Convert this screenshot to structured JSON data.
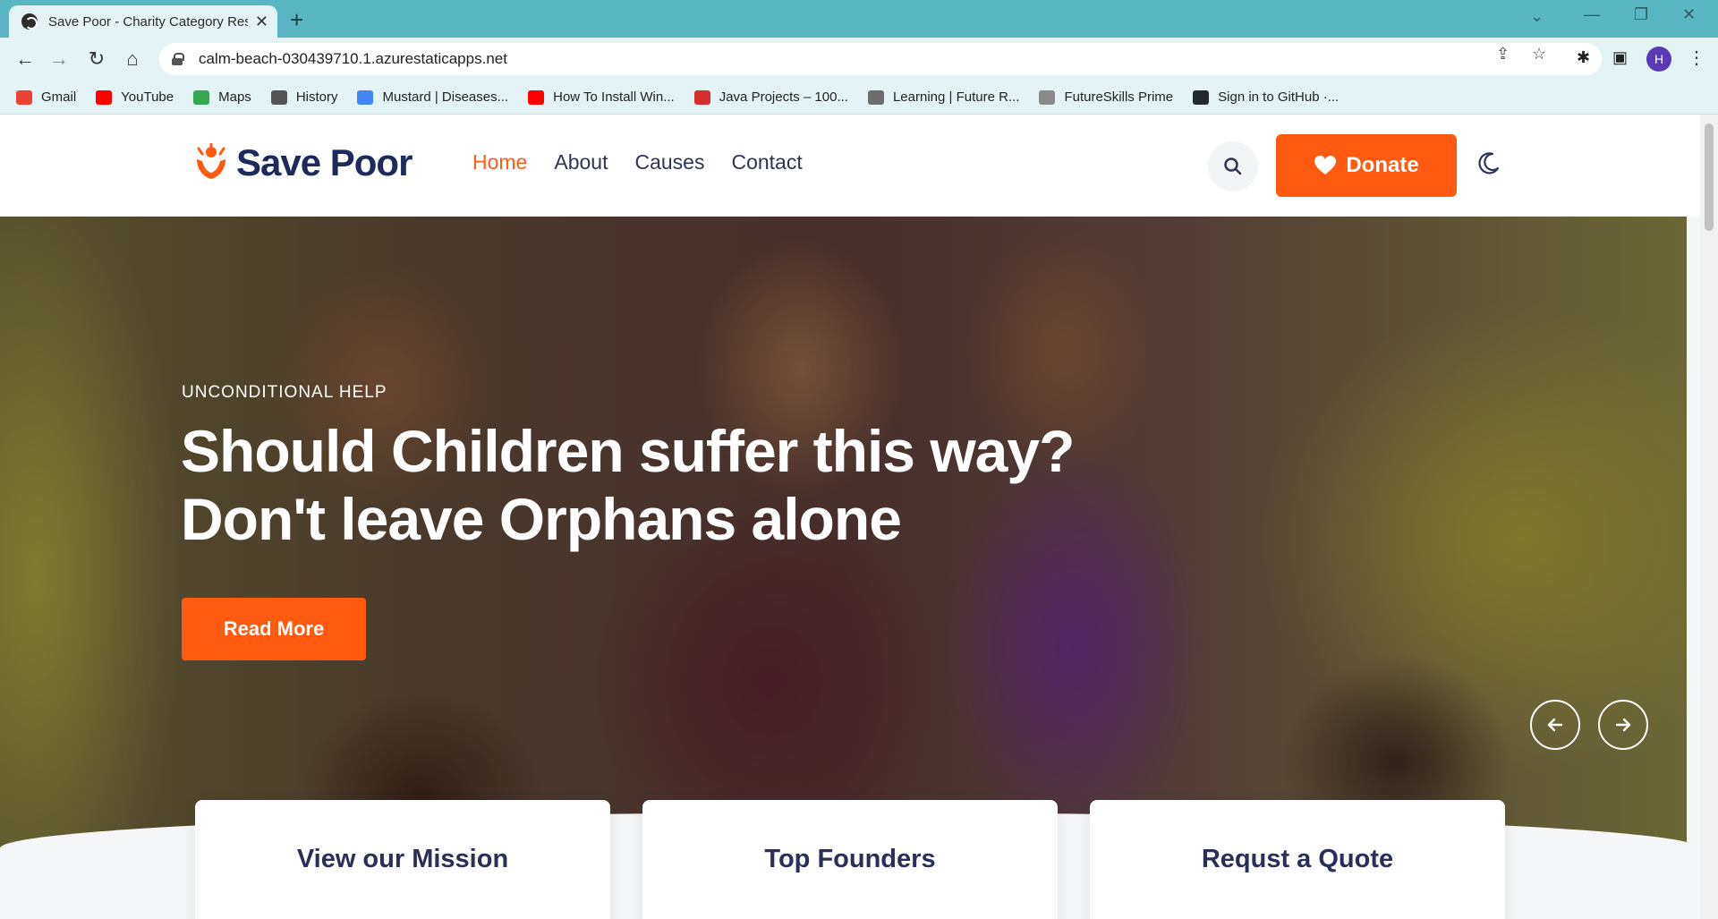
{
  "browser": {
    "tab_title": "Save Poor - Charity Category Res",
    "url": "calm-beach-030439710.1.azurestaticapps.net",
    "profile_initial": "H",
    "bookmarks": [
      {
        "label": "Gmail",
        "color": "#ea4335"
      },
      {
        "label": "YouTube",
        "color": "#ff0000"
      },
      {
        "label": "Maps",
        "color": "#34a853"
      },
      {
        "label": "History",
        "color": "#555555"
      },
      {
        "label": "Mustard | Diseases...",
        "color": "#4285f4"
      },
      {
        "label": "How To Install Win...",
        "color": "#ff0000"
      },
      {
        "label": "Java Projects – 100...",
        "color": "#d32f2f"
      },
      {
        "label": "Learning | Future R...",
        "color": "#6d6d6d"
      },
      {
        "label": "FutureSkills Prime",
        "color": "#8a8a8a"
      },
      {
        "label": "Sign in to GitHub ·...",
        "color": "#24292e"
      }
    ]
  },
  "site": {
    "logo_text": "Save Poor",
    "nav": [
      {
        "label": "Home",
        "active": true
      },
      {
        "label": "About",
        "active": false
      },
      {
        "label": "Causes",
        "active": false
      },
      {
        "label": "Contact",
        "active": false
      }
    ],
    "donate_label": "Donate",
    "accent_color": "#ff5a0f",
    "hero": {
      "subtitle": "UNCONDITIONAL HELP",
      "title_line1": "Should Children suffer this way?",
      "title_line2": "Don't leave Orphans alone",
      "button_label": "Read More"
    },
    "cards": [
      {
        "title": "View our Mission"
      },
      {
        "title": "Top Founders"
      },
      {
        "title": "Requst a Quote"
      }
    ]
  }
}
